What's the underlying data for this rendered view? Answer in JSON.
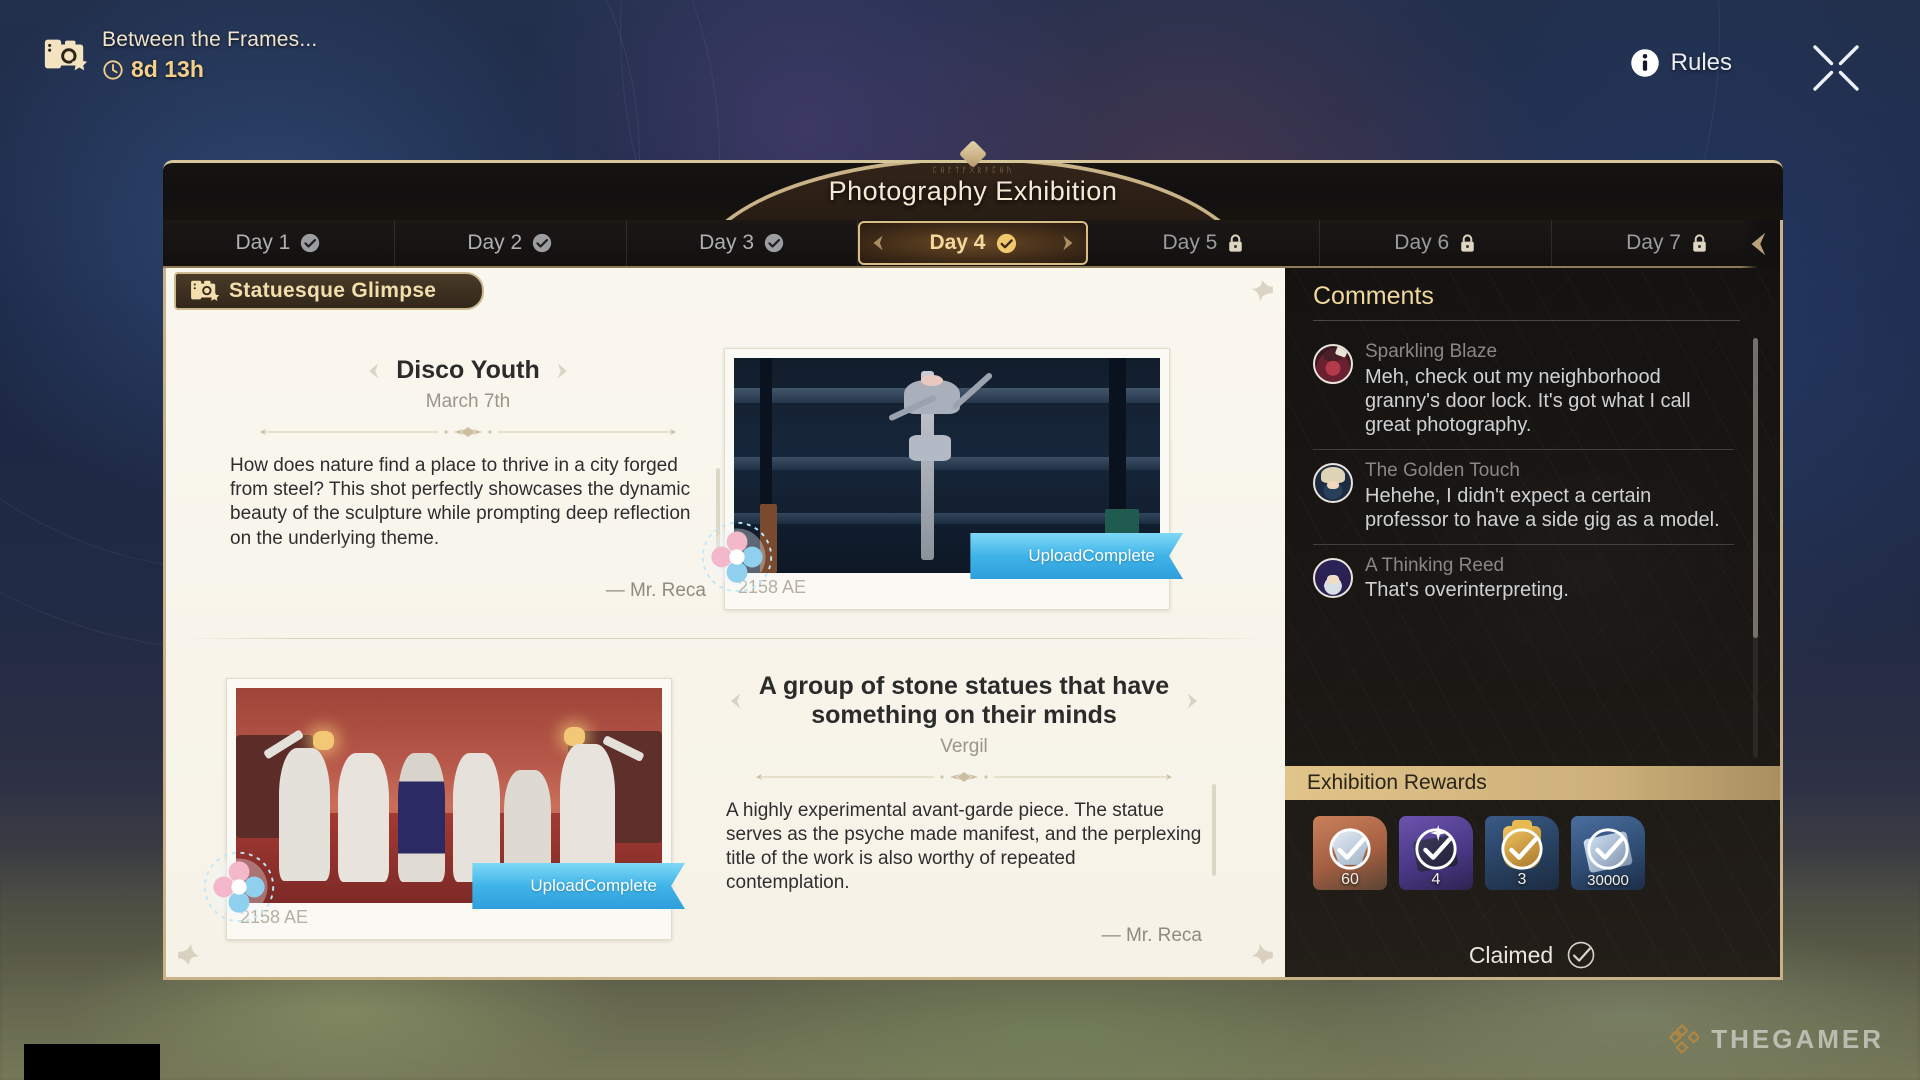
{
  "event": {
    "icon": "photo-camera-icon",
    "title": "Between the Frames...",
    "timer": "8d 13h",
    "timer_icon": "clock-icon"
  },
  "topbar": {
    "rules_label": "Rules",
    "rules_icon": "info-icon",
    "close_icon": "close-icon"
  },
  "window": {
    "title": "Photography Exhibition",
    "title_sub": "ᛈᚺᚩᛏᚩᚷᚱᚨᛈᚺᚤ"
  },
  "tabs": [
    {
      "label": "Day 1",
      "state": "completed",
      "icon": "check-circle-icon"
    },
    {
      "label": "Day 2",
      "state": "completed",
      "icon": "check-circle-icon"
    },
    {
      "label": "Day 3",
      "state": "completed",
      "icon": "check-circle-icon"
    },
    {
      "label": "Day 4",
      "state": "active",
      "icon": "check-circle-icon"
    },
    {
      "label": "Day 5",
      "state": "locked",
      "icon": "lock-icon"
    },
    {
      "label": "Day 6",
      "state": "locked",
      "icon": "lock-icon"
    },
    {
      "label": "Day 7",
      "state": "locked",
      "icon": "lock-icon"
    }
  ],
  "collection": {
    "label": "Statuesque Glimpse",
    "icon": "camera-stack-icon"
  },
  "entries": [
    {
      "title": "Disco Youth",
      "author": "March 7th",
      "body": "How does nature find a place to thrive in a city forged from steel? This shot perfectly showcases the dynamic beauty of the sculpture while prompting deep reflection on the underlying theme.",
      "signature": "— Mr. Reca",
      "photo_year": "2158 AE",
      "upload_status_line1": "Upload",
      "upload_status_line2": "Complete",
      "photo_alt": "robot-statue-photo"
    },
    {
      "title": "A group of stone statues that have something on their minds",
      "author": "Vergil",
      "body": "A highly experimental avant-garde piece. The statue serves as the psyche made manifest, and the perplexing title of the work is also worthy of repeated contemplation.",
      "signature": "— Mr. Reca",
      "photo_year": "2158 AE",
      "upload_status_line1": "Upload",
      "upload_status_line2": "Complete",
      "photo_alt": "stone-statues-group-photo"
    }
  ],
  "comments": {
    "heading": "Comments",
    "items": [
      {
        "user": "Sparkling Blaze",
        "text": "Meh, check out my neighborhood granny's door lock. It's got what I call great photography."
      },
      {
        "user": "The Golden Touch",
        "text": "Hehehe, I didn't expect a certain professor to have a side gig as a model."
      },
      {
        "user": "A Thinking Reed",
        "text": "That's overinterpreting."
      }
    ]
  },
  "rewards": {
    "heading": "Exhibition Rewards",
    "items": [
      {
        "name": "stellar-jade",
        "count": "60",
        "color": "#b7724d"
      },
      {
        "name": "purple-material",
        "count": "4",
        "color": "#5c4a93"
      },
      {
        "name": "gold-trophy",
        "count": "3",
        "color": "#2e4a72"
      },
      {
        "name": "credits",
        "count": "30000",
        "color": "#3a5a86"
      }
    ],
    "claimed_label": "Claimed",
    "claimed_icon": "check-circle-icon"
  },
  "watermark": {
    "text": "THEGAMER",
    "icon": "thegamer-logo-icon"
  },
  "colors": {
    "gold": "#d9bd85",
    "cream": "#f6f2e7",
    "accent_blue": "#3fb4e8",
    "panel_dark": "#1a1714"
  }
}
